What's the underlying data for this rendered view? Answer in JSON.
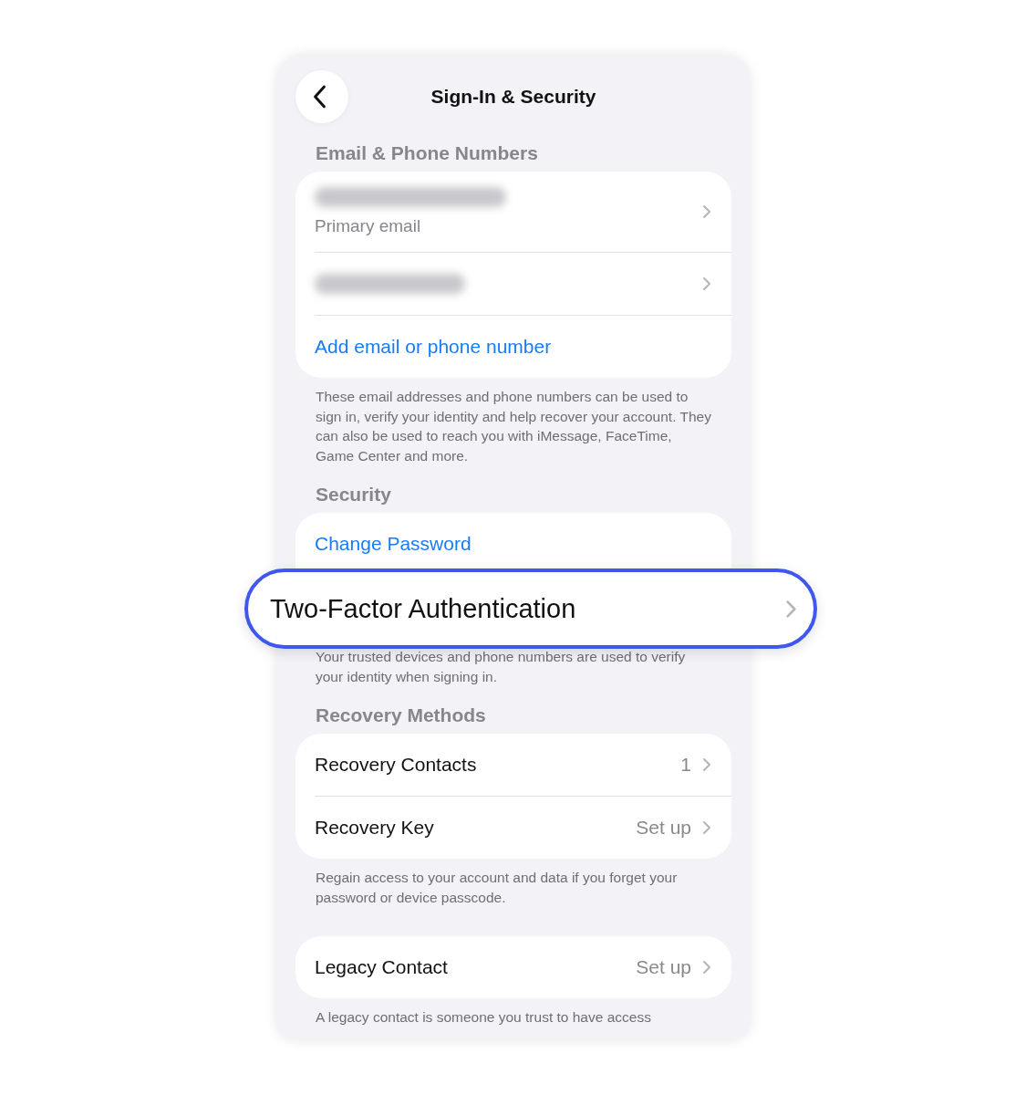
{
  "header": {
    "title": "Sign-In & Security"
  },
  "sections": [
    {
      "title": "Email & Phone Numbers",
      "rows": [
        {
          "kind": "blurred",
          "subtitle": "Primary email",
          "chevron": true
        },
        {
          "kind": "blurred",
          "chevron": true
        },
        {
          "kind": "link",
          "label": "Add email or phone number",
          "chevron": false
        }
      ],
      "footer": "These email addresses and phone numbers can be used to sign in, verify your identity and help recover your account. They can also be used to reach you with iMessage, FaceTime, Game Center and more."
    },
    {
      "title": "Security",
      "rows": [
        {
          "kind": "link",
          "label": "Change Password",
          "chevron": false
        },
        {
          "kind": "callout",
          "label": "Two-Factor Authentication",
          "chevron": true
        }
      ],
      "footer": "Your trusted devices and phone numbers are used to verify your identity when signing in."
    },
    {
      "title": "Recovery Methods",
      "rows": [
        {
          "kind": "plain",
          "label": "Recovery Contacts",
          "value": "1",
          "chevron": true
        },
        {
          "kind": "plain",
          "label": "Recovery Key",
          "value": "Set up",
          "chevron": true
        }
      ],
      "footer": "Regain access to your account and data if you forget your password or device passcode."
    },
    {
      "rows": [
        {
          "kind": "plain",
          "label": "Legacy Contact",
          "value": "Set up",
          "chevron": true
        }
      ],
      "footer": "A legacy contact is someone you trust to have access"
    }
  ]
}
